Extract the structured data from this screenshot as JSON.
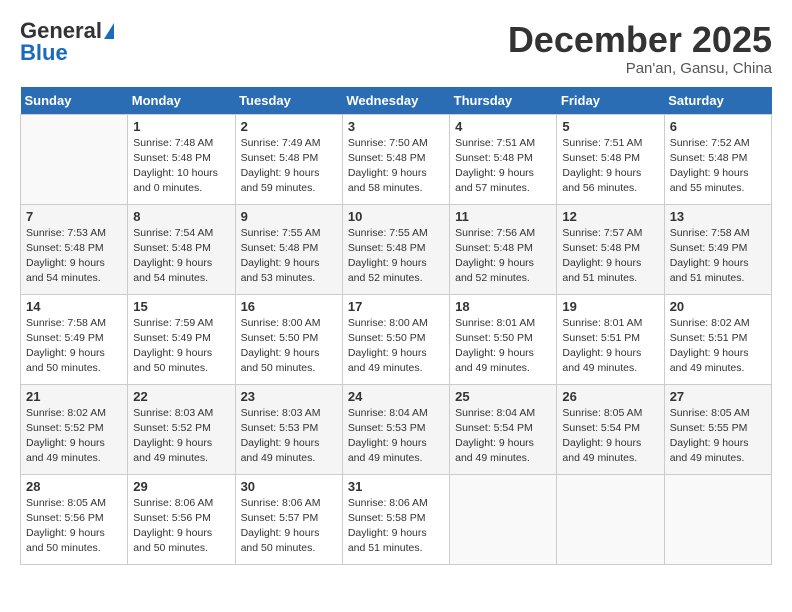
{
  "header": {
    "logo_general": "General",
    "logo_blue": "Blue",
    "month_title": "December 2025",
    "location": "Pan'an, Gansu, China"
  },
  "days_of_week": [
    "Sunday",
    "Monday",
    "Tuesday",
    "Wednesday",
    "Thursday",
    "Friday",
    "Saturday"
  ],
  "weeks": [
    [
      {
        "day": "",
        "empty": true
      },
      {
        "day": "1",
        "sunrise": "7:48 AM",
        "sunset": "5:48 PM",
        "daylight": "10 hours and 0 minutes."
      },
      {
        "day": "2",
        "sunrise": "7:49 AM",
        "sunset": "5:48 PM",
        "daylight": "9 hours and 59 minutes."
      },
      {
        "day": "3",
        "sunrise": "7:50 AM",
        "sunset": "5:48 PM",
        "daylight": "9 hours and 58 minutes."
      },
      {
        "day": "4",
        "sunrise": "7:51 AM",
        "sunset": "5:48 PM",
        "daylight": "9 hours and 57 minutes."
      },
      {
        "day": "5",
        "sunrise": "7:51 AM",
        "sunset": "5:48 PM",
        "daylight": "9 hours and 56 minutes."
      },
      {
        "day": "6",
        "sunrise": "7:52 AM",
        "sunset": "5:48 PM",
        "daylight": "9 hours and 55 minutes."
      }
    ],
    [
      {
        "day": "7",
        "sunrise": "7:53 AM",
        "sunset": "5:48 PM",
        "daylight": "9 hours and 54 minutes."
      },
      {
        "day": "8",
        "sunrise": "7:54 AM",
        "sunset": "5:48 PM",
        "daylight": "9 hours and 54 minutes."
      },
      {
        "day": "9",
        "sunrise": "7:55 AM",
        "sunset": "5:48 PM",
        "daylight": "9 hours and 53 minutes."
      },
      {
        "day": "10",
        "sunrise": "7:55 AM",
        "sunset": "5:48 PM",
        "daylight": "9 hours and 52 minutes."
      },
      {
        "day": "11",
        "sunrise": "7:56 AM",
        "sunset": "5:48 PM",
        "daylight": "9 hours and 52 minutes."
      },
      {
        "day": "12",
        "sunrise": "7:57 AM",
        "sunset": "5:48 PM",
        "daylight": "9 hours and 51 minutes."
      },
      {
        "day": "13",
        "sunrise": "7:58 AM",
        "sunset": "5:49 PM",
        "daylight": "9 hours and 51 minutes."
      }
    ],
    [
      {
        "day": "14",
        "sunrise": "7:58 AM",
        "sunset": "5:49 PM",
        "daylight": "9 hours and 50 minutes."
      },
      {
        "day": "15",
        "sunrise": "7:59 AM",
        "sunset": "5:49 PM",
        "daylight": "9 hours and 50 minutes."
      },
      {
        "day": "16",
        "sunrise": "8:00 AM",
        "sunset": "5:50 PM",
        "daylight": "9 hours and 50 minutes."
      },
      {
        "day": "17",
        "sunrise": "8:00 AM",
        "sunset": "5:50 PM",
        "daylight": "9 hours and 49 minutes."
      },
      {
        "day": "18",
        "sunrise": "8:01 AM",
        "sunset": "5:50 PM",
        "daylight": "9 hours and 49 minutes."
      },
      {
        "day": "19",
        "sunrise": "8:01 AM",
        "sunset": "5:51 PM",
        "daylight": "9 hours and 49 minutes."
      },
      {
        "day": "20",
        "sunrise": "8:02 AM",
        "sunset": "5:51 PM",
        "daylight": "9 hours and 49 minutes."
      }
    ],
    [
      {
        "day": "21",
        "sunrise": "8:02 AM",
        "sunset": "5:52 PM",
        "daylight": "9 hours and 49 minutes."
      },
      {
        "day": "22",
        "sunrise": "8:03 AM",
        "sunset": "5:52 PM",
        "daylight": "9 hours and 49 minutes."
      },
      {
        "day": "23",
        "sunrise": "8:03 AM",
        "sunset": "5:53 PM",
        "daylight": "9 hours and 49 minutes."
      },
      {
        "day": "24",
        "sunrise": "8:04 AM",
        "sunset": "5:53 PM",
        "daylight": "9 hours and 49 minutes."
      },
      {
        "day": "25",
        "sunrise": "8:04 AM",
        "sunset": "5:54 PM",
        "daylight": "9 hours and 49 minutes."
      },
      {
        "day": "26",
        "sunrise": "8:05 AM",
        "sunset": "5:54 PM",
        "daylight": "9 hours and 49 minutes."
      },
      {
        "day": "27",
        "sunrise": "8:05 AM",
        "sunset": "5:55 PM",
        "daylight": "9 hours and 49 minutes."
      }
    ],
    [
      {
        "day": "28",
        "sunrise": "8:05 AM",
        "sunset": "5:56 PM",
        "daylight": "9 hours and 50 minutes."
      },
      {
        "day": "29",
        "sunrise": "8:06 AM",
        "sunset": "5:56 PM",
        "daylight": "9 hours and 50 minutes."
      },
      {
        "day": "30",
        "sunrise": "8:06 AM",
        "sunset": "5:57 PM",
        "daylight": "9 hours and 50 minutes."
      },
      {
        "day": "31",
        "sunrise": "8:06 AM",
        "sunset": "5:58 PM",
        "daylight": "9 hours and 51 minutes."
      },
      {
        "day": "",
        "empty": true
      },
      {
        "day": "",
        "empty": true
      },
      {
        "day": "",
        "empty": true
      }
    ]
  ]
}
